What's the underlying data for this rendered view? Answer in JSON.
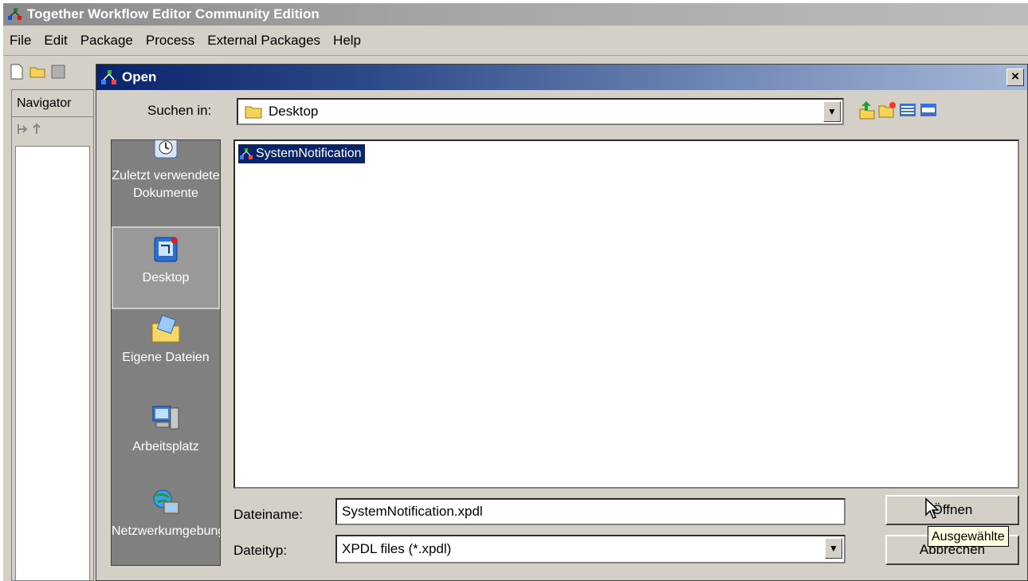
{
  "app": {
    "title": "Together Workflow Editor Community Edition",
    "menu": [
      "File",
      "Edit",
      "Package",
      "Process",
      "External Packages",
      "Help"
    ],
    "navigator_label": "Navigator"
  },
  "dialog": {
    "title": "Open",
    "close_label": "×",
    "look_in_label": "Suchen in:",
    "look_in_value": "Desktop",
    "places": [
      {
        "label": "Zuletzt verwendete Dokumente",
        "icon": "recent-documents-icon"
      },
      {
        "label": "Desktop",
        "icon": "desktop-icon"
      },
      {
        "label": "Eigene Dateien",
        "icon": "my-documents-icon"
      },
      {
        "label": "Arbeitsplatz",
        "icon": "my-computer-icon"
      },
      {
        "label": "Netzwerkumgebung",
        "icon": "network-icon"
      }
    ],
    "files": [
      {
        "name": "SystemNotification",
        "icon": "workflow-file-icon"
      }
    ],
    "file_name_label": "Dateiname:",
    "file_name_value": "SystemNotification.xpdl",
    "file_type_label": "Dateityp:",
    "file_type_value": "XPDL files (*.xpdl)",
    "open_button": "Öffnen",
    "cancel_button": "Abbrechen",
    "tooltip": "Ausgewählte"
  },
  "colors": {
    "dialog_title_start": "#0a246a",
    "selection": "#0a246a",
    "window_bg": "#d4d0c8",
    "places_bg": "#808080"
  }
}
